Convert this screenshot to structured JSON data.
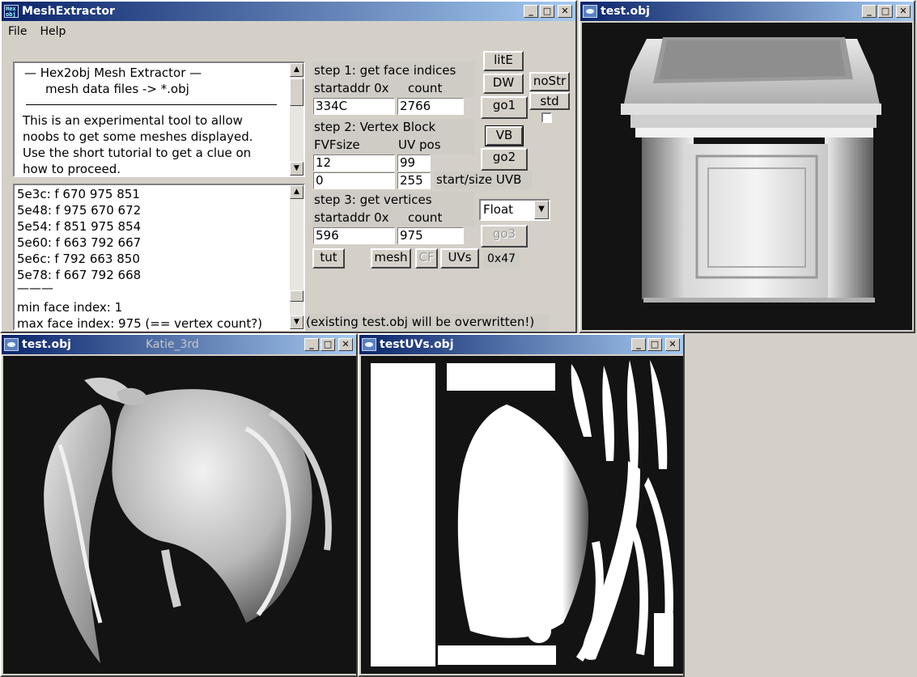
{
  "colors": {
    "title_active": "#0a246a",
    "title_inactive": "#808080",
    "viewport_bg": "#131313"
  },
  "main_window": {
    "title": "MeshExtractor",
    "app_icon_text": "Hex obj",
    "menu": {
      "file": "File",
      "help": "Help"
    },
    "info": {
      "heading": "—  Hex2obj Mesh Extractor  —",
      "subheading": "mesh data files -> *.obj",
      "body": [
        "This is an experimental tool to allow",
        "noobs to get some meshes displayed.",
        "Use the short tutorial to get a clue on",
        "how to proceed."
      ]
    },
    "log": {
      "lines": [
        "5e3c: f  670 975 851",
        "5e48: f  975 670 672",
        "5e54: f  851 975 854",
        "5e60: f  663 792 667",
        "5e6c: f  792 663 850",
        "5e78: f  667 792 668"
      ],
      "separator": "———",
      "min_label": "min face index: 1",
      "max_label": "max face index: 975 (== vertex count?)"
    },
    "step1": {
      "title": "step 1: get face indices",
      "col1": "startaddr 0x",
      "col2": "count",
      "addr": "334C",
      "count": "2766"
    },
    "step2": {
      "title": "step 2: Vertex Block",
      "col1": "FVFsize",
      "col2": "UV pos",
      "fvf": "12",
      "uvpos": "99",
      "start": "0",
      "size": "255",
      "uvb_label": "start/size UVB"
    },
    "step3": {
      "title": "step 3: get vertices",
      "col1": "startaddr 0x",
      "col2": "count",
      "addr": "596",
      "count": "975",
      "type": "Float"
    },
    "buttons": {
      "lite": "litE",
      "dw": "DW",
      "nostr": "noStr",
      "std": "std",
      "go1": "go1",
      "vb": "VB",
      "go2": "go2",
      "go3": "go3",
      "tut": "tut",
      "mesh": "mesh",
      "cf": "CF",
      "uvs": "UVs",
      "hex": "0x47"
    },
    "warning": "(existing test.obj will be overwritten!)"
  },
  "viewer_top": {
    "title": "test.obj"
  },
  "viewer_bottom": {
    "title": "test.obj",
    "subtitle": "Katie_3rd"
  },
  "uv_window": {
    "title": "testUVs.obj"
  }
}
